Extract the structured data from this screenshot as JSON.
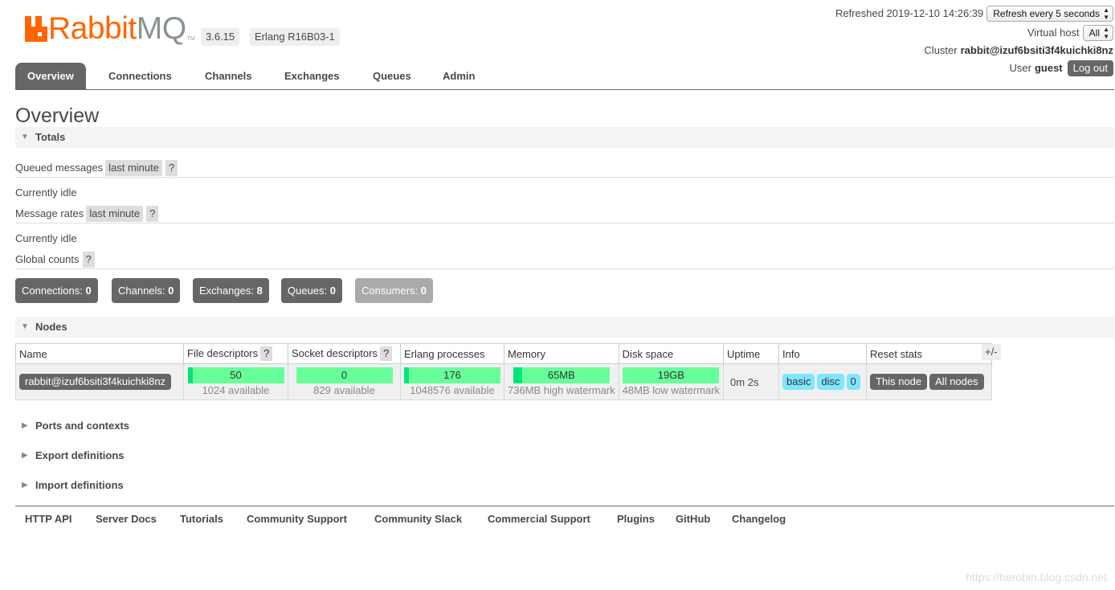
{
  "header": {
    "logo_text_rabbit": "Rabbit",
    "logo_text_mq": "MQ",
    "logo_tm": "TM",
    "version": "3.6.15",
    "erlang": "Erlang R16B03-1",
    "refreshed_label": "Refreshed 2019-12-10 14:26:39",
    "refresh_select": "Refresh every 5 seconds",
    "vhost_label": "Virtual host",
    "vhost_select": "All",
    "cluster_label": "Cluster",
    "cluster_name": "rabbit@izuf6bsiti3f4kuichki8nz",
    "user_label": "User",
    "user_name": "guest",
    "logout": "Log out"
  },
  "tabs": [
    "Overview",
    "Connections",
    "Channels",
    "Exchanges",
    "Queues",
    "Admin"
  ],
  "overview": {
    "title": "Overview",
    "totals": "Totals",
    "queued_label": "Queued messages",
    "queued_period": "last minute",
    "help": "?",
    "idle1": "Currently idle",
    "rates_label": "Message rates",
    "rates_period": "last minute",
    "idle2": "Currently idle",
    "global_label": "Global counts",
    "counts": [
      {
        "label": "Connections:",
        "value": "0"
      },
      {
        "label": "Channels:",
        "value": "0"
      },
      {
        "label": "Exchanges:",
        "value": "8"
      },
      {
        "label": "Queues:",
        "value": "0"
      },
      {
        "label": "Consumers:",
        "value": "0"
      }
    ]
  },
  "nodes": {
    "title": "Nodes",
    "headers": [
      "Name",
      "File descriptors",
      "Socket descriptors",
      "Erlang processes",
      "Memory",
      "Disk space",
      "Uptime",
      "Info",
      "Reset stats"
    ],
    "plusminus": "+/-",
    "row": {
      "name": "rabbit@izuf6bsiti3f4kuichki8nz",
      "fd": {
        "value": "50",
        "sub": "1024 available",
        "fill": 0.05
      },
      "sockets": {
        "value": "0",
        "sub": "829 available",
        "fill": 0
      },
      "processes": {
        "value": "176",
        "sub": "1048576 available",
        "fill": 0.0002
      },
      "memory": {
        "value": "65MB",
        "sub": "736MB high watermark",
        "fill": 0.088
      },
      "disk": {
        "value": "19GB",
        "sub": "48MB low watermark",
        "fill": 0
      },
      "uptime": "0m 2s",
      "info": [
        "basic",
        "disc",
        "0"
      ],
      "reset": [
        "This node",
        "All nodes"
      ]
    }
  },
  "sections": [
    "Ports and contexts",
    "Export definitions",
    "Import definitions"
  ],
  "footer": [
    "HTTP API",
    "Server Docs",
    "Tutorials",
    "Community Support",
    "Community Slack",
    "Commercial Support",
    "Plugins",
    "GitHub",
    "Changelog"
  ],
  "watermark": "https://herobin.blog.csdn.net"
}
